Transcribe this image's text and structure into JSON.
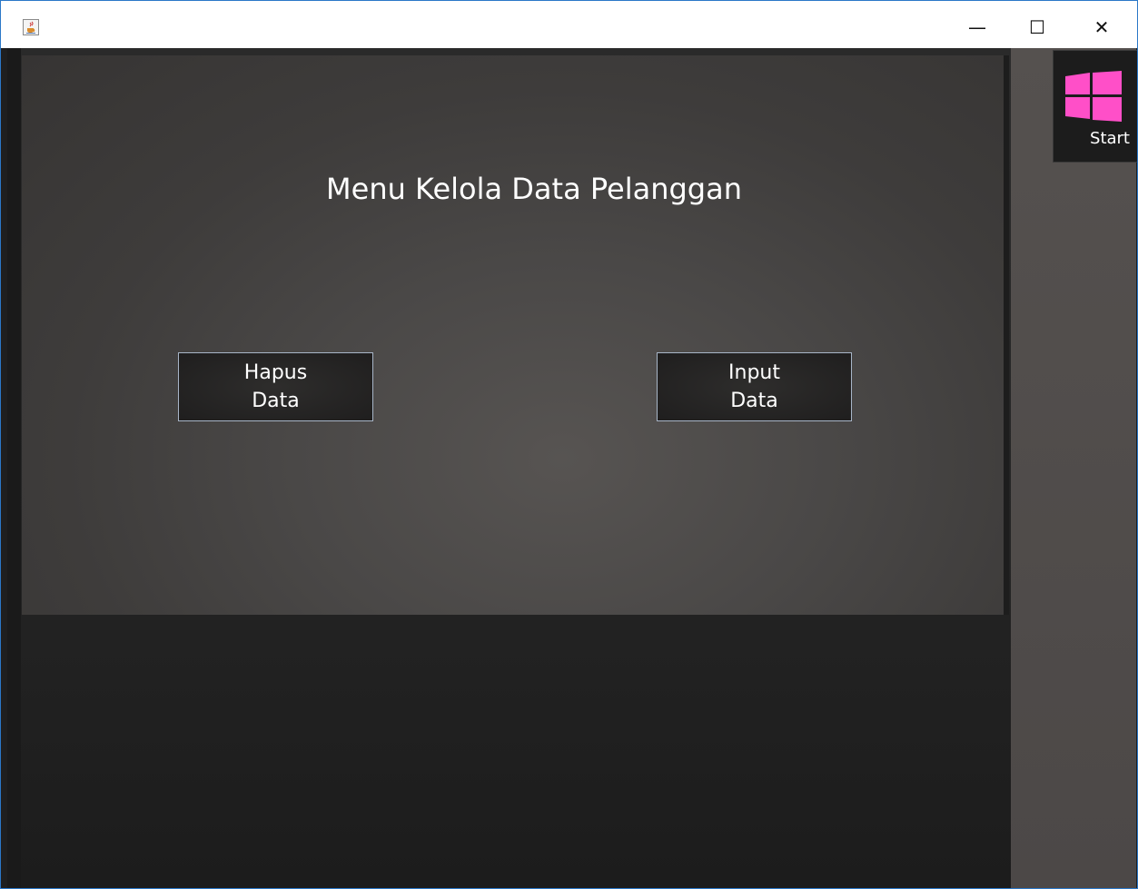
{
  "window": {
    "icon": "java-cup-icon",
    "controls": {
      "minimize": "—",
      "maximize": "☐",
      "close": "✕"
    }
  },
  "main": {
    "title": "Menu Kelola Data Pelanggan",
    "buttons": {
      "delete": {
        "line1": "Hapus",
        "line2": "Data"
      },
      "input": {
        "line1": "Input",
        "line2": "Data"
      }
    }
  },
  "start_tile": {
    "label": "Start",
    "icon": "windows-logo-icon",
    "icon_color": "#ff4fc8"
  },
  "colors": {
    "panel": "#4a4847",
    "button_border": "#a8b6c8",
    "accent": "#ff4fc8"
  }
}
